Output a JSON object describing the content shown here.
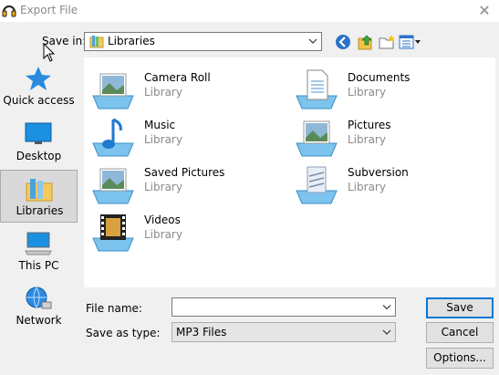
{
  "window": {
    "title": "Export File",
    "close_glyph": "✕"
  },
  "save_in": {
    "label": "Save in:",
    "value": "Libraries"
  },
  "places": [
    {
      "label": "Quick access",
      "icon": "star-icon"
    },
    {
      "label": "Desktop",
      "icon": "desktop-icon"
    },
    {
      "label": "Libraries",
      "icon": "libraries-icon",
      "selected": true
    },
    {
      "label": "This PC",
      "icon": "computer-icon"
    },
    {
      "label": "Network",
      "icon": "network-icon"
    }
  ],
  "files": [
    {
      "name": "Camera Roll",
      "type": "Library",
      "icon": "pictures-library-icon"
    },
    {
      "name": "Documents",
      "type": "Library",
      "icon": "documents-library-icon"
    },
    {
      "name": "Music",
      "type": "Library",
      "icon": "music-library-icon"
    },
    {
      "name": "Pictures",
      "type": "Library",
      "icon": "pictures-library-icon"
    },
    {
      "name": "Saved Pictures",
      "type": "Library",
      "icon": "pictures-library-icon"
    },
    {
      "name": "Subversion",
      "type": "Library",
      "icon": "subversion-library-icon"
    },
    {
      "name": "Videos",
      "type": "Library",
      "icon": "videos-library-icon"
    }
  ],
  "file_name": {
    "label": "File name:",
    "value": ""
  },
  "save_as_type": {
    "label": "Save as type:",
    "value": "MP3 Files"
  },
  "buttons": {
    "save": "Save",
    "cancel": "Cancel",
    "options": "Options..."
  }
}
